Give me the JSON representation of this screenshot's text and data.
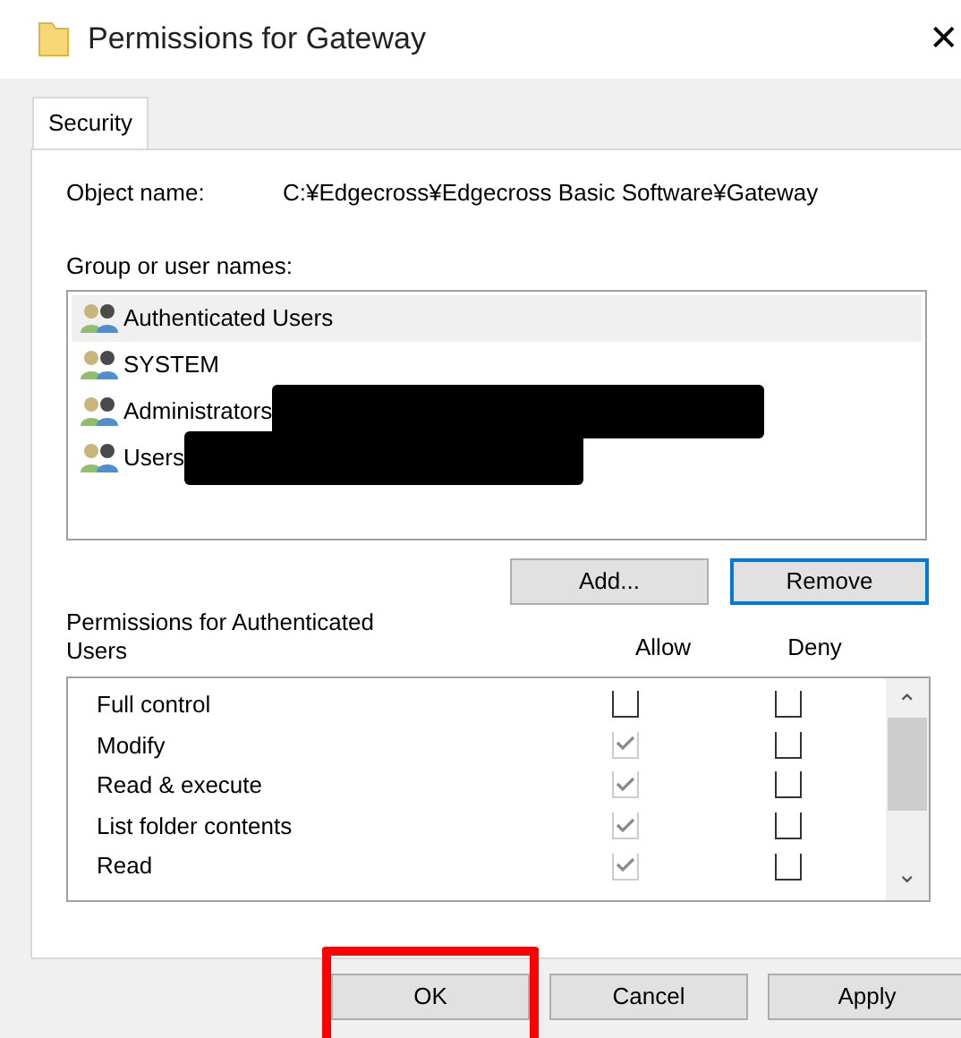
{
  "window": {
    "title": "Permissions for Gateway",
    "close": "✕"
  },
  "tabs": [
    {
      "label": "Security",
      "selected": true
    }
  ],
  "object_name": {
    "label": "Object name:",
    "value": "C:¥Edgecross¥Edgecross Basic Software¥Gateway"
  },
  "group_list": {
    "label": "Group or user names:",
    "items": [
      {
        "name": "Authenticated Users",
        "selected": true,
        "redacted": false
      },
      {
        "name": "SYSTEM",
        "selected": false,
        "redacted": false
      },
      {
        "name": "Administrators",
        "selected": false,
        "redacted": true
      },
      {
        "name": "Users",
        "selected": false,
        "redacted": true
      }
    ]
  },
  "list_buttons": [
    {
      "label": "Add...",
      "focused": false
    },
    {
      "label": "Remove",
      "focused": true
    }
  ],
  "permissions": {
    "label": "Permissions for Authenticated Users",
    "columns": [
      "Allow",
      "Deny"
    ],
    "scroll_up": "⌃",
    "scroll_down": "⌄",
    "rows": [
      {
        "name": "Full control",
        "allow": {
          "checked": false,
          "disabled": false
        },
        "deny": {
          "checked": false,
          "disabled": false
        }
      },
      {
        "name": "Modify",
        "allow": {
          "checked": true,
          "disabled": true
        },
        "deny": {
          "checked": false,
          "disabled": false
        }
      },
      {
        "name": "Read & execute",
        "allow": {
          "checked": true,
          "disabled": true
        },
        "deny": {
          "checked": false,
          "disabled": false
        }
      },
      {
        "name": "List folder contents",
        "allow": {
          "checked": true,
          "disabled": true
        },
        "deny": {
          "checked": false,
          "disabled": false
        }
      },
      {
        "name": "Read",
        "allow": {
          "checked": true,
          "disabled": true
        },
        "deny": {
          "checked": false,
          "disabled": false
        }
      }
    ]
  },
  "buttons": [
    {
      "label": "OK",
      "highlighted": true
    },
    {
      "label": "Cancel",
      "highlighted": false
    },
    {
      "label": "Apply",
      "highlighted": false
    }
  ]
}
